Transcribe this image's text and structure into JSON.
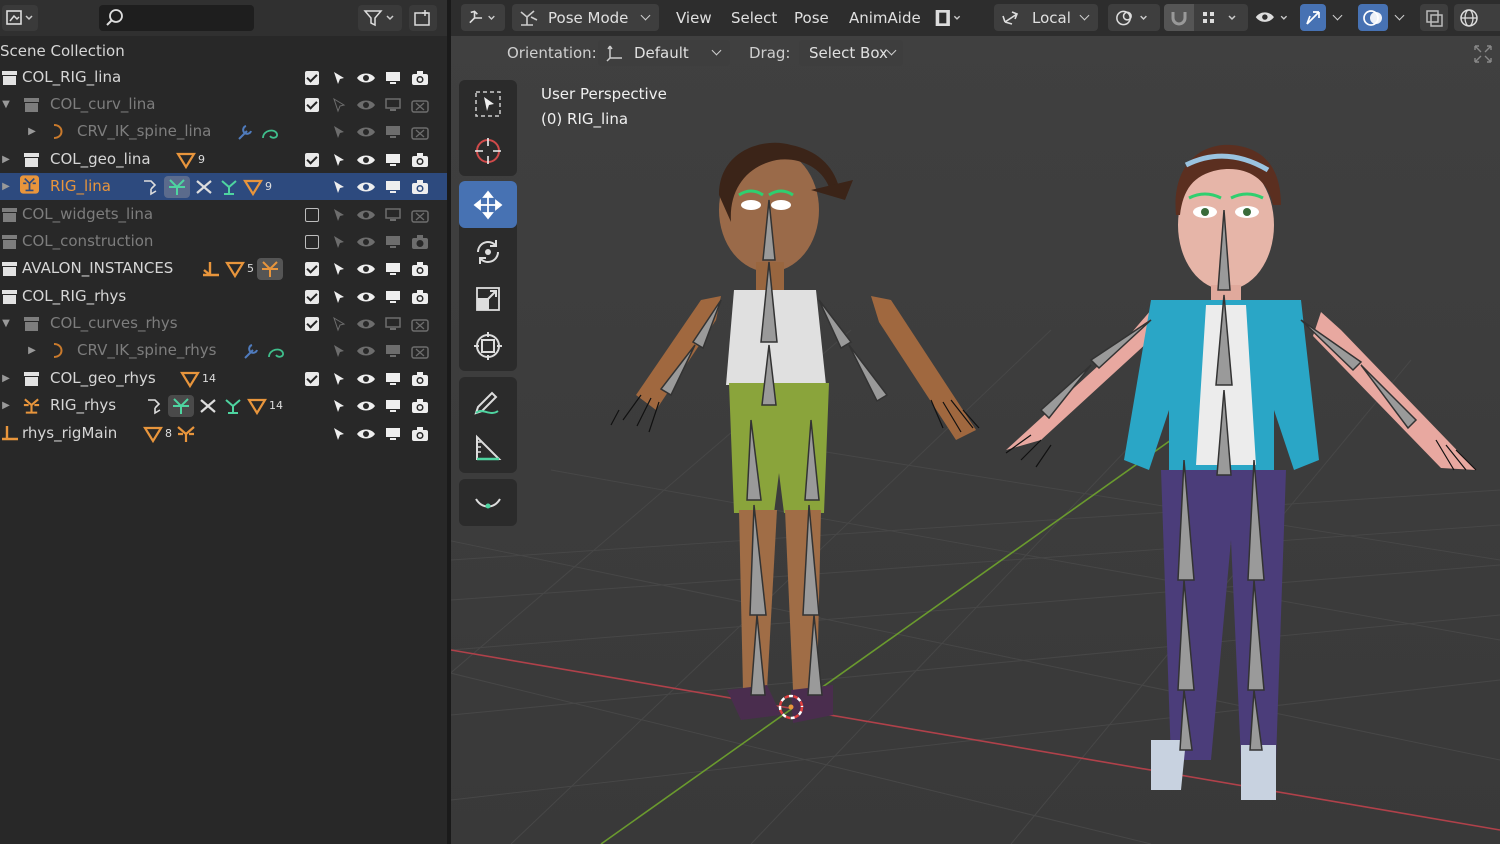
{
  "outliner": {
    "scene_collection_label": "Scene Collection",
    "rows": [
      {
        "label": "COL_RIG_lina",
        "dim": false,
        "selected": false
      },
      {
        "label": "COL_curv_lina",
        "dim": true,
        "selected": false
      },
      {
        "label": "CRV_IK_spine_lina",
        "dim": true,
        "selected": false
      },
      {
        "label": "COL_geo_lina",
        "dim": false,
        "selected": false,
        "badge": "9"
      },
      {
        "label": "RIG_lina",
        "dim": false,
        "selected": true,
        "badge": "9"
      },
      {
        "label": "COL_widgets_lina",
        "dim": true,
        "selected": false
      },
      {
        "label": "COL_construction",
        "dim": true,
        "selected": false
      },
      {
        "label": "AVALON_INSTANCES",
        "dim": false,
        "selected": false,
        "badge": "5"
      },
      {
        "label": "COL_RIG_rhys",
        "dim": false,
        "selected": false
      },
      {
        "label": "COL_curves_rhys",
        "dim": true,
        "selected": false
      },
      {
        "label": "CRV_IK_spine_rhys",
        "dim": true,
        "selected": false
      },
      {
        "label": "COL_geo_rhys",
        "dim": false,
        "selected": false,
        "badge": "14"
      },
      {
        "label": "RIG_rhys",
        "dim": false,
        "selected": false,
        "badge": "14"
      },
      {
        "label": "rhys_rigMain",
        "dim": false,
        "selected": false,
        "badge": "8"
      }
    ]
  },
  "viewport": {
    "header": {
      "mode_label": "Pose Mode",
      "menu_view": "View",
      "menu_select": "Select",
      "menu_pose": "Pose",
      "menu_animaide": "AnimAide",
      "transform_orientation": "Local"
    },
    "tool_settings": {
      "orientation_label": "Orientation:",
      "orientation_value": "Default",
      "drag_label": "Drag:",
      "drag_value": "Select Box"
    },
    "overlay": {
      "perspective": "User Perspective",
      "object_info": "(0) RIG_lina"
    }
  },
  "colors": {
    "accent_blue": "#4772b3",
    "selection_row": "#2d4a7e",
    "orange_icon": "#e8953c",
    "green_icon": "#4ed4a0",
    "x_axis": "#b0414a",
    "y_axis": "#6a9a2e"
  }
}
